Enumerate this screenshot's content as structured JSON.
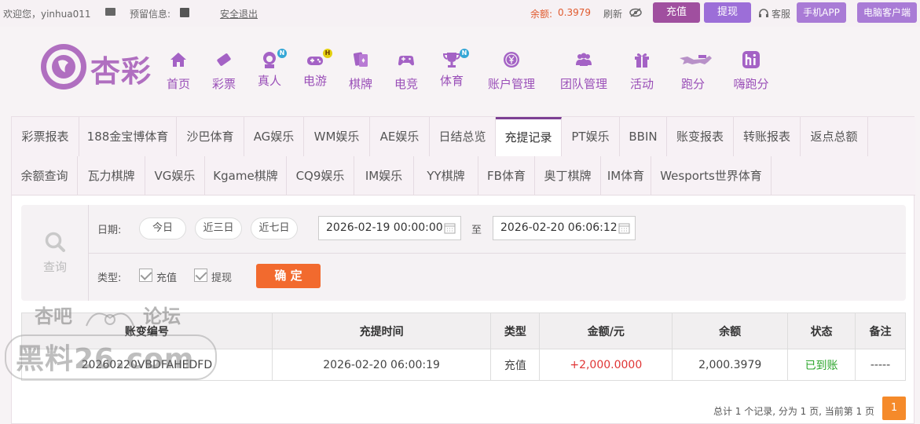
{
  "topbar": {
    "welcome": "欢迎您，yinhua011",
    "reserved_info": "预留信息:",
    "logout": "安全退出",
    "balance_label": "余额:",
    "balance_value": "0.3979",
    "refresh": "刷新",
    "recharge": "充值",
    "withdraw": "提现",
    "support": "客服",
    "mobile_app": "手机APP",
    "pc_client": "电脑客户端"
  },
  "logo": {
    "text": "杏彩"
  },
  "nav": [
    {
      "label": "首页",
      "icon": "home-icon"
    },
    {
      "label": "彩票",
      "icon": "lottery-ticket-icon"
    },
    {
      "label": "真人",
      "icon": "live-dealer-icon",
      "badge": "N"
    },
    {
      "label": "电游",
      "icon": "gamepad-icon",
      "badge": "H"
    },
    {
      "label": "棋牌",
      "icon": "cards-icon"
    },
    {
      "label": "电竞",
      "icon": "esports-controller-icon"
    },
    {
      "label": "体育",
      "icon": "trophy-icon",
      "badge": "N"
    },
    {
      "label": "账户管理",
      "icon": "account-coin-icon"
    },
    {
      "label": "团队管理",
      "icon": "team-icon"
    },
    {
      "label": "活动",
      "icon": "gift-icon"
    },
    {
      "label": "跑分",
      "icon": "running-dog-icon"
    },
    {
      "label": "嗨跑分",
      "icon": "hi-icon"
    }
  ],
  "tabs_row1": [
    "彩票报表",
    "188金宝博体育",
    "沙巴体育",
    "AG娱乐",
    "WM娱乐",
    "AE娱乐",
    "日结总览",
    "充提记录",
    "PT娱乐",
    "BBIN",
    "账变报表",
    "转账报表",
    "返点总额"
  ],
  "tabs_row2": [
    "余额查询",
    "瓦力棋牌",
    "VG娱乐",
    "Kgame棋牌",
    "CQ9娱乐",
    "IM娱乐",
    "YY棋牌",
    "FB体育",
    "奥丁棋牌",
    "IM体育",
    "Wesports世界体育"
  ],
  "active_tab": "充提记录",
  "search": {
    "query_label": "查询",
    "date_label": "日期:",
    "today": "今日",
    "last3": "近三日",
    "last7": "近七日",
    "start": "2026-02-19 00:00:00",
    "to": "至",
    "end": "2026-02-20 06:06:12",
    "type_label": "类型:",
    "type_recharge": "充值",
    "type_withdraw": "提现",
    "confirm": "确 定"
  },
  "table": {
    "headers": [
      "账变编号",
      "充提时间",
      "类型",
      "金额/元",
      "余额",
      "状态",
      "备注"
    ],
    "rows": [
      [
        "20260220VBDFAHEDFD",
        "2026-02-20 06:00:19",
        "充值",
        "+2,000.0000",
        "2,000.3979",
        "已到账",
        "-----"
      ]
    ]
  },
  "pager": {
    "summary": "总计 1 个记录, 分为 1 页, 当前第 1 页",
    "current": "1"
  },
  "watermark": {
    "line1": "杏吧",
    "line2": "论坛",
    "line3": "黑料26.com"
  },
  "colors": {
    "purple": "#a462c5",
    "accent": "#7c3f93",
    "orange": "#f26a2e",
    "red": "#e03535",
    "green": "#2aa52a"
  }
}
